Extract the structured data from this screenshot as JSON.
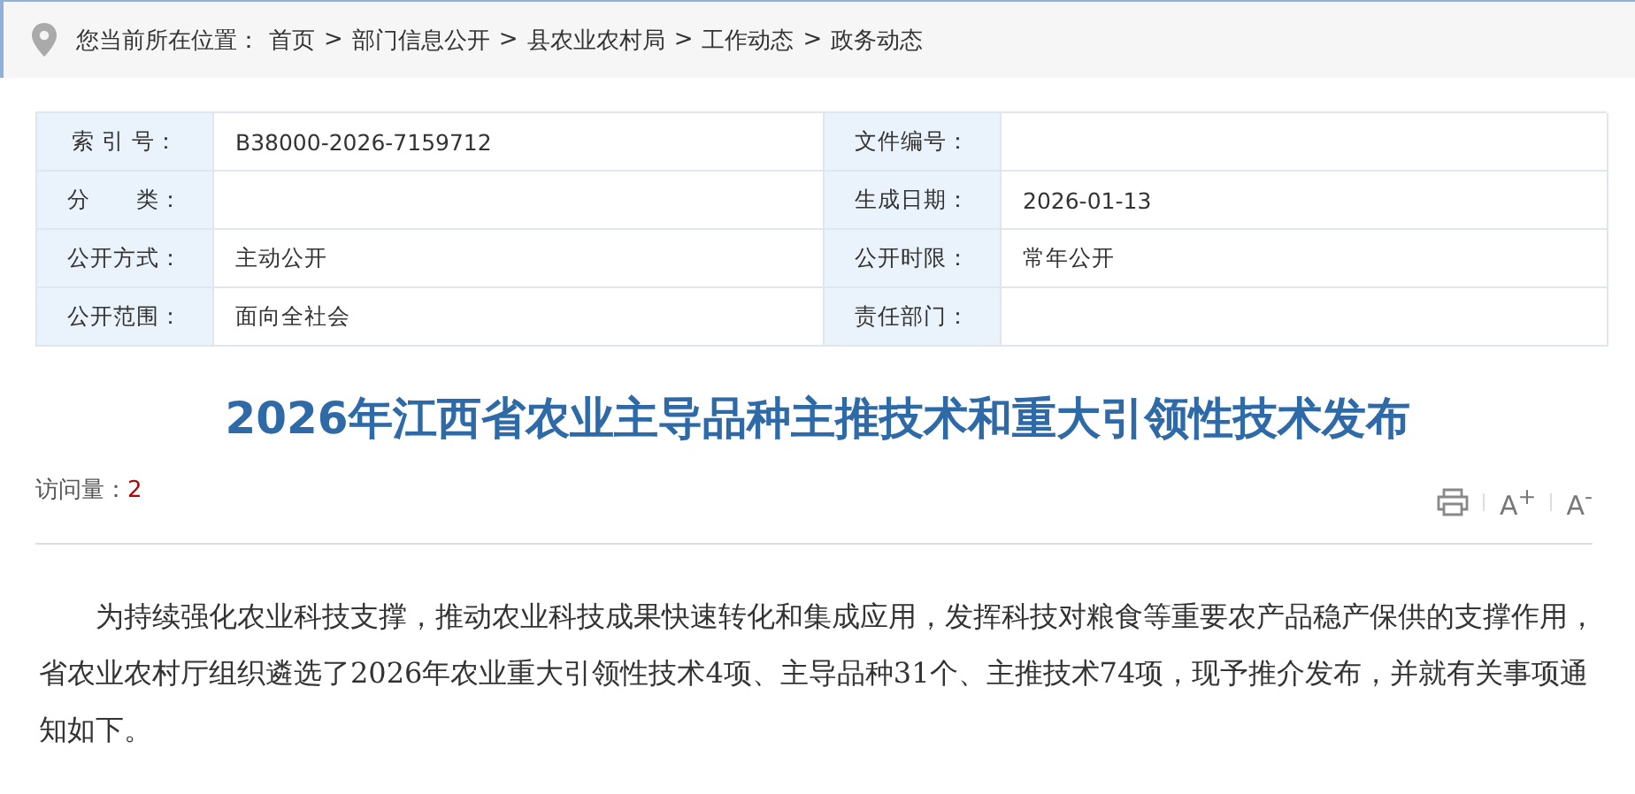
{
  "breadcrumb": {
    "label": "您当前所在位置：",
    "separator": ">",
    "items": [
      "首页",
      "部门信息公开",
      "县农业农村局",
      "工作动态",
      "政务动态"
    ]
  },
  "info_table": {
    "rows": [
      [
        {
          "label": "索 引 号：",
          "value": "B38000-2026-7159712"
        },
        {
          "label": "文件编号："
        }
      ],
      [
        {
          "label": "分　　类："
        },
        {
          "label": "生成日期：",
          "value": "2026-01-13"
        }
      ],
      [
        {
          "label": "公开方式：",
          "value": "主动公开"
        },
        {
          "label": "公开时限：",
          "value": "常年公开"
        }
      ],
      [
        {
          "label": "公开范围：",
          "value": "面向全社会"
        },
        {
          "label": "责任部门："
        }
      ]
    ]
  },
  "article": {
    "title": "2026年江西省农业主导品种主推技术和重大引领性技术发布",
    "visits_label": "访问量：",
    "visits": "2",
    "tools": [
      {
        "kind": "print"
      },
      {
        "kind": "text",
        "text": "A$^{+}$"
      },
      {
        "kind": "text",
        "text": "A$^{-}$"
      }
    ],
    "body": "为持续强化农业科技支撑，推动农业科技成果快速转化和集成应用，发挥科技对粮食等重要农产品稳产保供的支撑作用，省农业农村厅组织遴选了2026年农业重大引领性技术4项、主导品种31个、主推技术74项，现予推介发布，并就有关事项通知如下。"
  }
}
